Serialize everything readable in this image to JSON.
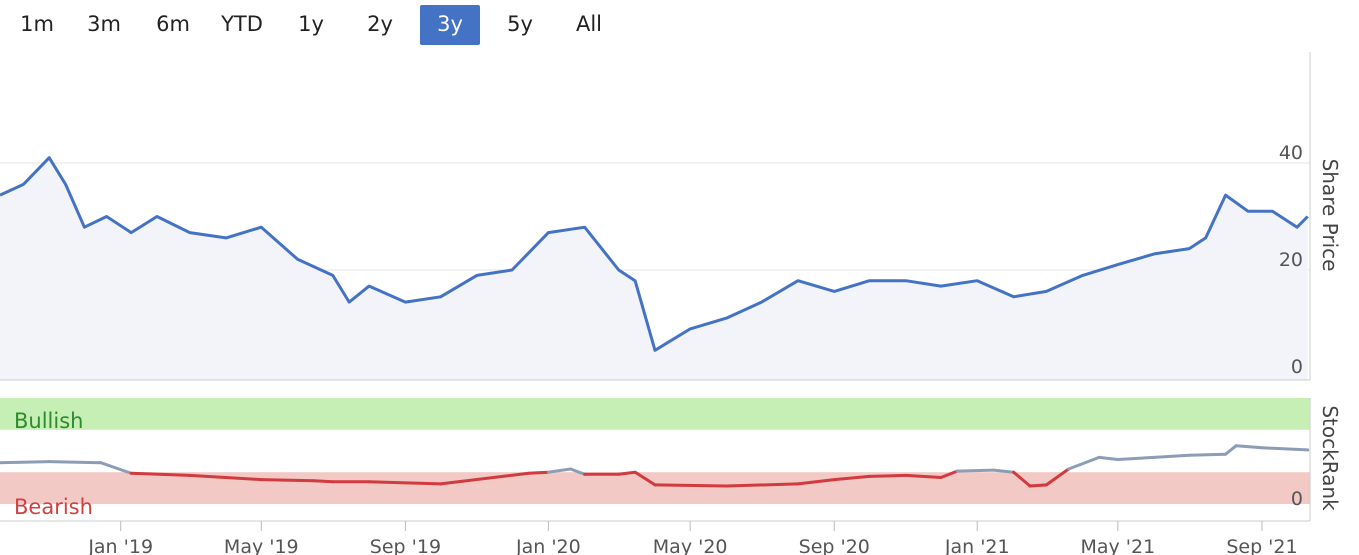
{
  "range_selector": {
    "buttons": [
      {
        "label": "1m",
        "active": false
      },
      {
        "label": "3m",
        "active": false
      },
      {
        "label": "6m",
        "active": false
      },
      {
        "label": "YTD",
        "active": false
      },
      {
        "label": "1y",
        "active": false
      },
      {
        "label": "2y",
        "active": false
      },
      {
        "label": "3y",
        "active": true
      },
      {
        "label": "5y",
        "active": false
      },
      {
        "label": "All",
        "active": false
      }
    ]
  },
  "colors": {
    "accent": "#4472c4",
    "price_line": "#4472c4",
    "price_fill": "#f3f4f9",
    "bullish_band": "#c6efb6",
    "bullish_text": "#2e8b2e",
    "bearish_band": "#f2c9c4",
    "bearish_text": "#d0403c",
    "rank_bearish_line": "#d13a3f",
    "rank_neutral_line": "#8c9db5",
    "grid": "#e6e6e6"
  },
  "chart_data": [
    {
      "type": "line",
      "name": "share-price",
      "ylabel": "Share Price",
      "ylim": [
        0,
        60
      ],
      "yticks": [
        0,
        20,
        40
      ],
      "xlim": [
        "2018-09-20",
        "2021-10-12"
      ],
      "x": [
        "2018-09-20",
        "2018-10-10",
        "2018-11-01",
        "2018-11-15",
        "2018-12-01",
        "2018-12-20",
        "2019-01-10",
        "2019-02-01",
        "2019-03-01",
        "2019-04-01",
        "2019-05-01",
        "2019-06-01",
        "2019-07-01",
        "2019-07-15",
        "2019-08-01",
        "2019-09-01",
        "2019-10-01",
        "2019-11-01",
        "2019-12-01",
        "2020-01-01",
        "2020-02-01",
        "2020-03-01",
        "2020-03-15",
        "2020-04-01",
        "2020-05-01",
        "2020-06-01",
        "2020-07-01",
        "2020-08-01",
        "2020-09-01",
        "2020-10-01",
        "2020-11-01",
        "2020-12-01",
        "2021-01-01",
        "2021-02-01",
        "2021-03-01",
        "2021-04-01",
        "2021-05-01",
        "2021-06-01",
        "2021-07-01",
        "2021-07-15",
        "2021-08-01",
        "2021-08-20",
        "2021-09-10",
        "2021-10-01",
        "2021-10-10"
      ],
      "y": [
        34,
        36,
        41,
        36,
        28,
        30,
        27,
        30,
        27,
        26,
        28,
        22,
        19,
        14,
        17,
        14,
        15,
        19,
        20,
        27,
        28,
        20,
        18,
        5,
        9,
        11,
        14,
        18,
        16,
        18,
        18,
        17,
        18,
        15,
        16,
        19,
        21,
        23,
        24,
        26,
        34,
        31,
        31,
        28,
        30
      ]
    },
    {
      "type": "line",
      "name": "stockrank",
      "ylabel": "StockRank",
      "zones": [
        {
          "label": "Bullish",
          "from": 70,
          "to": 100
        },
        {
          "label": "Bearish",
          "from": 0,
          "to": 30
        }
      ],
      "yticks": [
        0
      ],
      "ylim": [
        0,
        100
      ],
      "xlim": [
        "2018-09-20",
        "2021-10-12"
      ],
      "xticks": [
        "Jan '19",
        "May '19",
        "Sep '19",
        "Jan '20",
        "May '20",
        "Sep '20",
        "Jan '21",
        "May '21",
        "Sep '21"
      ],
      "x": [
        "2018-09-20",
        "2018-11-01",
        "2018-12-15",
        "2019-01-10",
        "2019-03-01",
        "2019-05-01",
        "2019-06-15",
        "2019-07-01",
        "2019-08-01",
        "2019-10-01",
        "2019-12-15",
        "2020-01-01",
        "2020-01-20",
        "2020-02-01",
        "2020-03-01",
        "2020-03-15",
        "2020-04-01",
        "2020-06-01",
        "2020-08-01",
        "2020-09-01",
        "2020-10-01",
        "2020-11-01",
        "2020-12-01",
        "2020-12-15",
        "2021-01-15",
        "2021-02-01",
        "2021-02-15",
        "2021-03-01",
        "2021-03-20",
        "2021-04-15",
        "2021-05-01",
        "2021-06-01",
        "2021-07-01",
        "2021-08-01",
        "2021-08-10",
        "2021-09-01",
        "2021-10-10"
      ],
      "y": [
        39,
        40,
        39,
        29,
        27,
        23,
        22,
        21,
        21,
        19,
        29,
        30,
        33,
        28,
        28,
        30,
        18,
        17,
        19,
        23,
        26,
        27,
        25,
        31,
        32,
        30,
        17,
        18,
        33,
        44,
        42,
        44,
        46,
        47,
        55,
        53,
        51
      ]
    }
  ]
}
